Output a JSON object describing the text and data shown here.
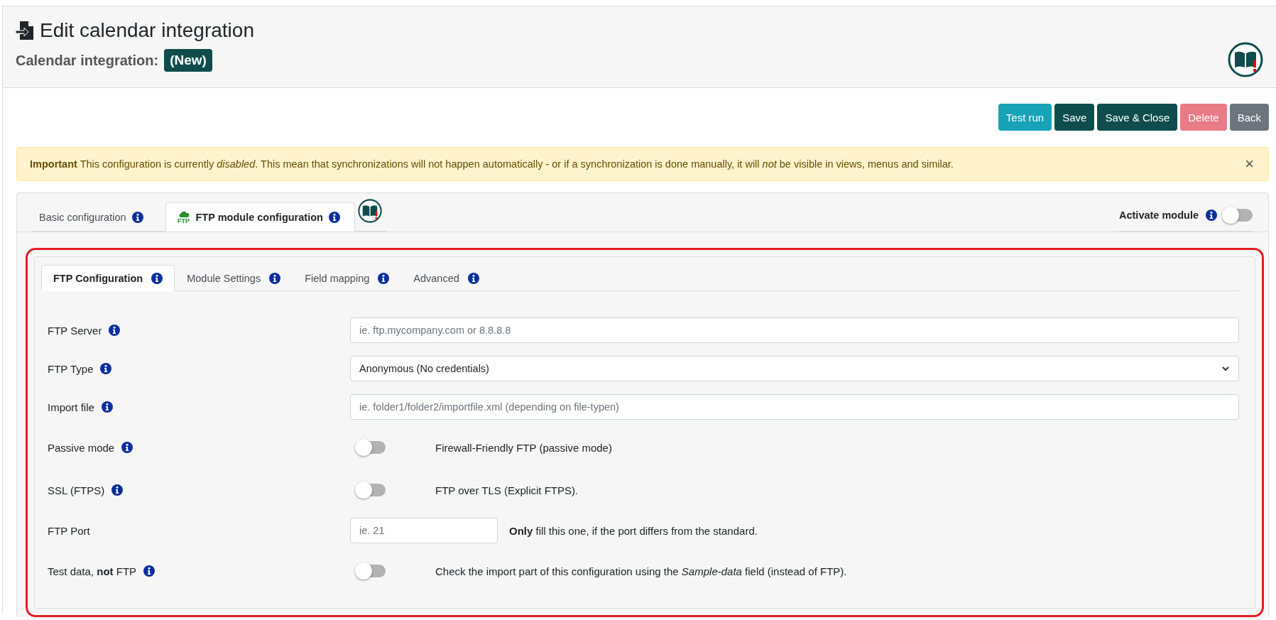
{
  "header": {
    "title": "Edit calendar integration",
    "subtitle": "Calendar integration:",
    "badge": "(New)"
  },
  "actions": [
    {
      "label": "Test run",
      "kind": "info",
      "disabled": false
    },
    {
      "label": "Save",
      "kind": "primary",
      "disabled": false
    },
    {
      "label": "Save & Close",
      "kind": "primary",
      "disabled": false
    },
    {
      "label": "Delete",
      "kind": "danger",
      "disabled": true
    },
    {
      "label": "Back",
      "kind": "secondary",
      "disabled": false
    }
  ],
  "alert": {
    "text": "**Important** This configuration is currently *disabled*. This mean that synchronizations will not happen automatically - or if a synchronization is done manually, it will *not* be visible in views, menus and similar.",
    "close": "×"
  },
  "module_tabs": [
    {
      "label": "Basic configuration",
      "selected": false
    },
    {
      "label": "FTP module configuration",
      "selected": true,
      "icon_label": "FTP"
    }
  ],
  "activate_module": {
    "label": "Activate module",
    "on": false
  },
  "sub_tabs": [
    {
      "label": "FTP Configuration",
      "selected": true
    },
    {
      "label": "Module Settings",
      "selected": false
    },
    {
      "label": "Field mapping",
      "selected": false
    },
    {
      "label": "Advanced",
      "selected": false
    }
  ],
  "fields": [
    {
      "kind": "text",
      "label": "FTP Server",
      "info": true,
      "placeholder": "ie. ftp.mycompany.com or 8.8.8.8"
    },
    {
      "kind": "select",
      "label": "FTP Type",
      "info": true,
      "value": "Anonymous (No credentials)"
    },
    {
      "kind": "text",
      "label": "Import file",
      "info": true,
      "placeholder": "ie. folder1/folder2/importfile.xml (depending on file-typen)"
    },
    {
      "kind": "toggle",
      "label": "Passive mode",
      "info": true,
      "on": false,
      "description": "Firewall-Friendly FTP (passive mode)"
    },
    {
      "kind": "toggle",
      "label": "SSL (FTPS)",
      "info": true,
      "on": false,
      "description": "FTP over TLS (Explicit FTPS)."
    },
    {
      "kind": "short",
      "label": "FTP Port",
      "info": false,
      "placeholder": "ie. 21",
      "description": "**Only** fill this one, if the port differs from the standard."
    },
    {
      "kind": "toggle",
      "label": "Test data, **not** FTP",
      "info": true,
      "on": false,
      "description": "Check the import part of this configuration using the *Sample-data* field (instead of FTP)."
    }
  ]
}
